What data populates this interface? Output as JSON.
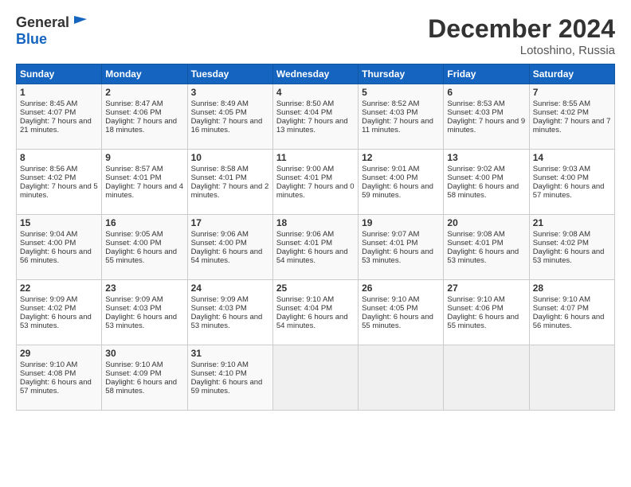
{
  "header": {
    "logo_general": "General",
    "logo_blue": "Blue",
    "month_title": "December 2024",
    "location": "Lotoshino, Russia"
  },
  "days_of_week": [
    "Sunday",
    "Monday",
    "Tuesday",
    "Wednesday",
    "Thursday",
    "Friday",
    "Saturday"
  ],
  "weeks": [
    [
      {
        "day": "1",
        "sunrise": "Sunrise: 8:45 AM",
        "sunset": "Sunset: 4:07 PM",
        "daylight": "Daylight: 7 hours and 21 minutes."
      },
      {
        "day": "2",
        "sunrise": "Sunrise: 8:47 AM",
        "sunset": "Sunset: 4:06 PM",
        "daylight": "Daylight: 7 hours and 18 minutes."
      },
      {
        "day": "3",
        "sunrise": "Sunrise: 8:49 AM",
        "sunset": "Sunset: 4:05 PM",
        "daylight": "Daylight: 7 hours and 16 minutes."
      },
      {
        "day": "4",
        "sunrise": "Sunrise: 8:50 AM",
        "sunset": "Sunset: 4:04 PM",
        "daylight": "Daylight: 7 hours and 13 minutes."
      },
      {
        "day": "5",
        "sunrise": "Sunrise: 8:52 AM",
        "sunset": "Sunset: 4:03 PM",
        "daylight": "Daylight: 7 hours and 11 minutes."
      },
      {
        "day": "6",
        "sunrise": "Sunrise: 8:53 AM",
        "sunset": "Sunset: 4:03 PM",
        "daylight": "Daylight: 7 hours and 9 minutes."
      },
      {
        "day": "7",
        "sunrise": "Sunrise: 8:55 AM",
        "sunset": "Sunset: 4:02 PM",
        "daylight": "Daylight: 7 hours and 7 minutes."
      }
    ],
    [
      {
        "day": "8",
        "sunrise": "Sunrise: 8:56 AM",
        "sunset": "Sunset: 4:02 PM",
        "daylight": "Daylight: 7 hours and 5 minutes."
      },
      {
        "day": "9",
        "sunrise": "Sunrise: 8:57 AM",
        "sunset": "Sunset: 4:01 PM",
        "daylight": "Daylight: 7 hours and 4 minutes."
      },
      {
        "day": "10",
        "sunrise": "Sunrise: 8:58 AM",
        "sunset": "Sunset: 4:01 PM",
        "daylight": "Daylight: 7 hours and 2 minutes."
      },
      {
        "day": "11",
        "sunrise": "Sunrise: 9:00 AM",
        "sunset": "Sunset: 4:01 PM",
        "daylight": "Daylight: 7 hours and 0 minutes."
      },
      {
        "day": "12",
        "sunrise": "Sunrise: 9:01 AM",
        "sunset": "Sunset: 4:00 PM",
        "daylight": "Daylight: 6 hours and 59 minutes."
      },
      {
        "day": "13",
        "sunrise": "Sunrise: 9:02 AM",
        "sunset": "Sunset: 4:00 PM",
        "daylight": "Daylight: 6 hours and 58 minutes."
      },
      {
        "day": "14",
        "sunrise": "Sunrise: 9:03 AM",
        "sunset": "Sunset: 4:00 PM",
        "daylight": "Daylight: 6 hours and 57 minutes."
      }
    ],
    [
      {
        "day": "15",
        "sunrise": "Sunrise: 9:04 AM",
        "sunset": "Sunset: 4:00 PM",
        "daylight": "Daylight: 6 hours and 56 minutes."
      },
      {
        "day": "16",
        "sunrise": "Sunrise: 9:05 AM",
        "sunset": "Sunset: 4:00 PM",
        "daylight": "Daylight: 6 hours and 55 minutes."
      },
      {
        "day": "17",
        "sunrise": "Sunrise: 9:06 AM",
        "sunset": "Sunset: 4:00 PM",
        "daylight": "Daylight: 6 hours and 54 minutes."
      },
      {
        "day": "18",
        "sunrise": "Sunrise: 9:06 AM",
        "sunset": "Sunset: 4:01 PM",
        "daylight": "Daylight: 6 hours and 54 minutes."
      },
      {
        "day": "19",
        "sunrise": "Sunrise: 9:07 AM",
        "sunset": "Sunset: 4:01 PM",
        "daylight": "Daylight: 6 hours and 53 minutes."
      },
      {
        "day": "20",
        "sunrise": "Sunrise: 9:08 AM",
        "sunset": "Sunset: 4:01 PM",
        "daylight": "Daylight: 6 hours and 53 minutes."
      },
      {
        "day": "21",
        "sunrise": "Sunrise: 9:08 AM",
        "sunset": "Sunset: 4:02 PM",
        "daylight": "Daylight: 6 hours and 53 minutes."
      }
    ],
    [
      {
        "day": "22",
        "sunrise": "Sunrise: 9:09 AM",
        "sunset": "Sunset: 4:02 PM",
        "daylight": "Daylight: 6 hours and 53 minutes."
      },
      {
        "day": "23",
        "sunrise": "Sunrise: 9:09 AM",
        "sunset": "Sunset: 4:03 PM",
        "daylight": "Daylight: 6 hours and 53 minutes."
      },
      {
        "day": "24",
        "sunrise": "Sunrise: 9:09 AM",
        "sunset": "Sunset: 4:03 PM",
        "daylight": "Daylight: 6 hours and 53 minutes."
      },
      {
        "day": "25",
        "sunrise": "Sunrise: 9:10 AM",
        "sunset": "Sunset: 4:04 PM",
        "daylight": "Daylight: 6 hours and 54 minutes."
      },
      {
        "day": "26",
        "sunrise": "Sunrise: 9:10 AM",
        "sunset": "Sunset: 4:05 PM",
        "daylight": "Daylight: 6 hours and 55 minutes."
      },
      {
        "day": "27",
        "sunrise": "Sunrise: 9:10 AM",
        "sunset": "Sunset: 4:06 PM",
        "daylight": "Daylight: 6 hours and 55 minutes."
      },
      {
        "day": "28",
        "sunrise": "Sunrise: 9:10 AM",
        "sunset": "Sunset: 4:07 PM",
        "daylight": "Daylight: 6 hours and 56 minutes."
      }
    ],
    [
      {
        "day": "29",
        "sunrise": "Sunrise: 9:10 AM",
        "sunset": "Sunset: 4:08 PM",
        "daylight": "Daylight: 6 hours and 57 minutes."
      },
      {
        "day": "30",
        "sunrise": "Sunrise: 9:10 AM",
        "sunset": "Sunset: 4:09 PM",
        "daylight": "Daylight: 6 hours and 58 minutes."
      },
      {
        "day": "31",
        "sunrise": "Sunrise: 9:10 AM",
        "sunset": "Sunset: 4:10 PM",
        "daylight": "Daylight: 6 hours and 59 minutes."
      },
      null,
      null,
      null,
      null
    ]
  ]
}
